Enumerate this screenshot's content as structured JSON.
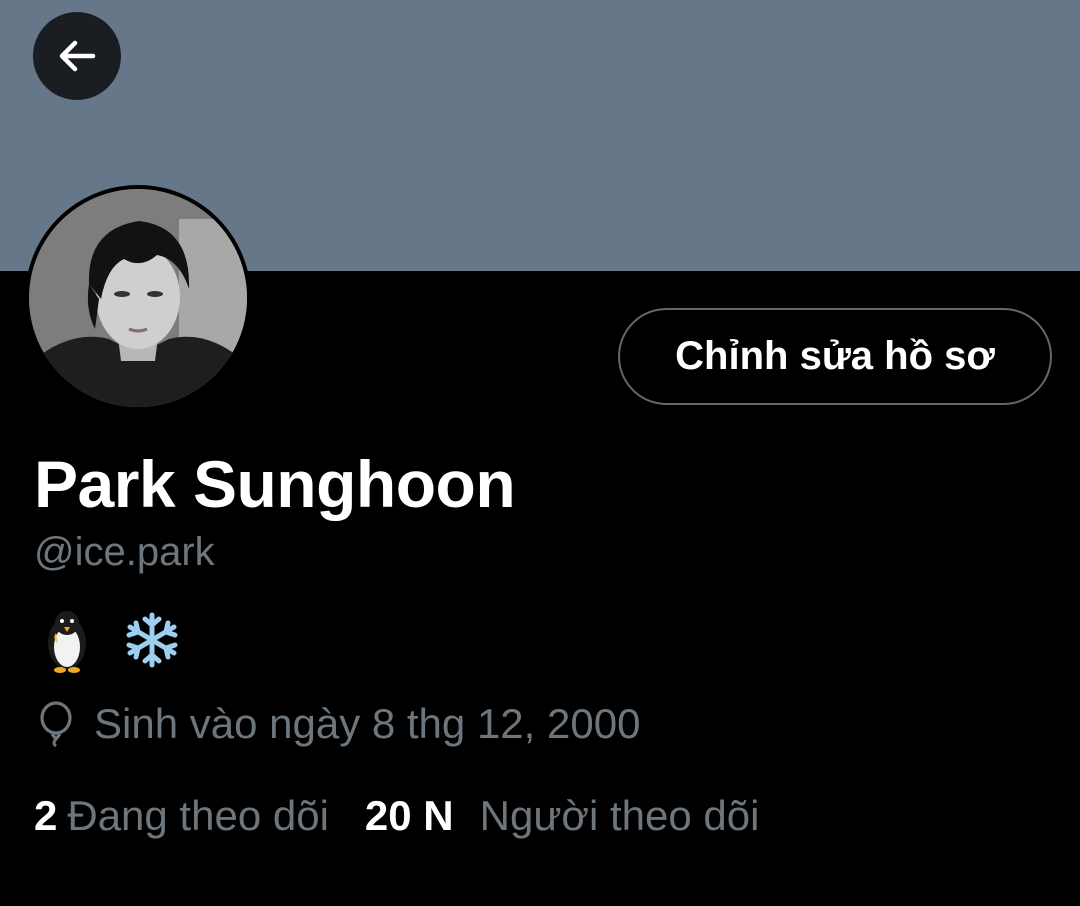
{
  "header": {
    "banner_color": "#66778a",
    "back_icon": "arrow-left-icon"
  },
  "profile": {
    "avatar_icon": "user-avatar",
    "edit_button_label": "Chỉnh sửa hồ sơ",
    "display_name": "Park Sunghoon",
    "handle": "@ice.park",
    "bio_emojis": [
      "penguin",
      "snowflake"
    ],
    "birthday_icon": "balloon-icon",
    "birthday_text": "Sinh vào ngày 8 thg 12, 2000"
  },
  "stats": {
    "following_count": "2",
    "following_label": "Đang theo dõi",
    "followers_count": "20 N",
    "followers_label": "Người theo dõi"
  },
  "colors": {
    "background": "#000000",
    "primary_text": "#ffffff",
    "secondary_text": "#6e767d",
    "button_border": "#5d6870"
  }
}
